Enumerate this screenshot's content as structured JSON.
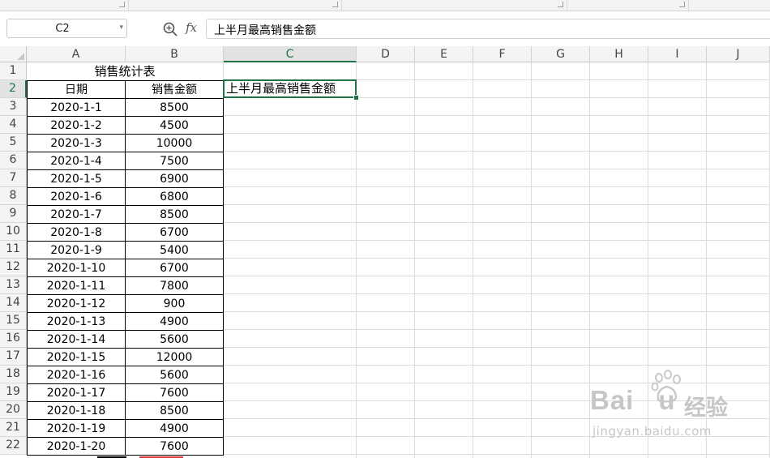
{
  "formula_bar": {
    "name_box_value": "C2",
    "fx_label": "fx",
    "formula_value": "上半月最高销售金额"
  },
  "columns": [
    "A",
    "B",
    "C",
    "D",
    "E",
    "F",
    "G",
    "H",
    "I",
    "J"
  ],
  "active_column": "C",
  "rows": [
    "1",
    "2",
    "3",
    "4",
    "5",
    "6",
    "7",
    "8",
    "9",
    "10",
    "11",
    "12",
    "13",
    "14",
    "15",
    "16",
    "17",
    "18",
    "19",
    "20",
    "21",
    "22"
  ],
  "active_row": "2",
  "table": {
    "title": "销售统计表",
    "headers": [
      "日期",
      "销售金额"
    ],
    "records": [
      {
        "date": "2020-1-1",
        "amount": "8500"
      },
      {
        "date": "2020-1-2",
        "amount": "4500"
      },
      {
        "date": "2020-1-3",
        "amount": "10000"
      },
      {
        "date": "2020-1-4",
        "amount": "7500"
      },
      {
        "date": "2020-1-5",
        "amount": "6900"
      },
      {
        "date": "2020-1-6",
        "amount": "6800"
      },
      {
        "date": "2020-1-7",
        "amount": "8500"
      },
      {
        "date": "2020-1-8",
        "amount": "6700"
      },
      {
        "date": "2020-1-9",
        "amount": "5400"
      },
      {
        "date": "2020-1-10",
        "amount": "6700"
      },
      {
        "date": "2020-1-11",
        "amount": "7800"
      },
      {
        "date": "2020-1-12",
        "amount": "900"
      },
      {
        "date": "2020-1-13",
        "amount": "4900"
      },
      {
        "date": "2020-1-14",
        "amount": "5600"
      },
      {
        "date": "2020-1-15",
        "amount": "12000"
      },
      {
        "date": "2020-1-16",
        "amount": "5600"
      },
      {
        "date": "2020-1-17",
        "amount": "7600"
      },
      {
        "date": "2020-1-18",
        "amount": "8500"
      },
      {
        "date": "2020-1-19",
        "amount": "4900"
      },
      {
        "date": "2020-1-20",
        "amount": "7600"
      }
    ]
  },
  "selected_cell": {
    "ref": "C2",
    "value": "上半月最高销售金额"
  },
  "watermark": {
    "brand": "Bai",
    "brand_tail": "u",
    "cn": "经验",
    "url": "jingyan.baidu.com"
  },
  "colors": {
    "accent": "#217346",
    "gridline": "#dcdcdc",
    "header_bg": "#f4f4f4"
  }
}
